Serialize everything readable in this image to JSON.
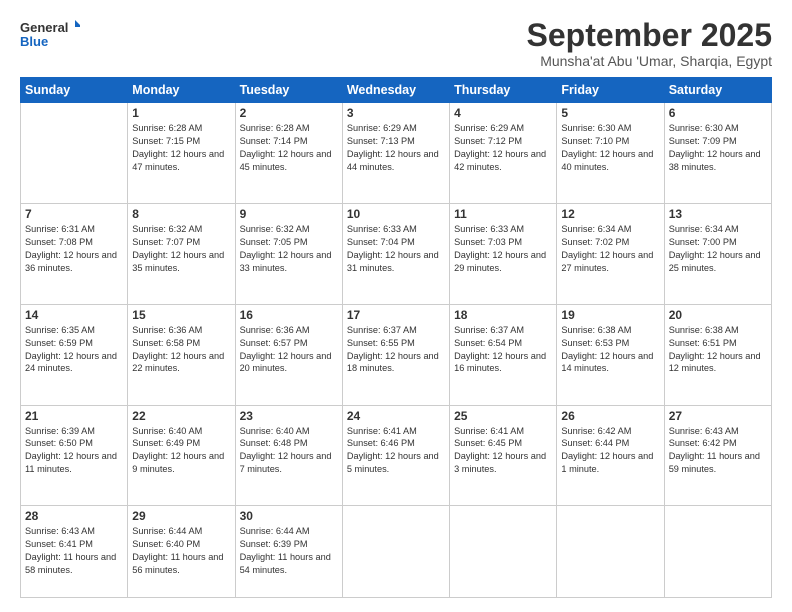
{
  "logo": {
    "line1": "General",
    "line2": "Blue"
  },
  "title": "September 2025",
  "location": "Munsha'at Abu 'Umar, Sharqia, Egypt",
  "days_of_week": [
    "Sunday",
    "Monday",
    "Tuesday",
    "Wednesday",
    "Thursday",
    "Friday",
    "Saturday"
  ],
  "weeks": [
    [
      {
        "day": "",
        "info": ""
      },
      {
        "day": "1",
        "info": "Sunrise: 6:28 AM\nSunset: 7:15 PM\nDaylight: 12 hours and 47 minutes."
      },
      {
        "day": "2",
        "info": "Sunrise: 6:28 AM\nSunset: 7:14 PM\nDaylight: 12 hours and 45 minutes."
      },
      {
        "day": "3",
        "info": "Sunrise: 6:29 AM\nSunset: 7:13 PM\nDaylight: 12 hours and 44 minutes."
      },
      {
        "day": "4",
        "info": "Sunrise: 6:29 AM\nSunset: 7:12 PM\nDaylight: 12 hours and 42 minutes."
      },
      {
        "day": "5",
        "info": "Sunrise: 6:30 AM\nSunset: 7:10 PM\nDaylight: 12 hours and 40 minutes."
      },
      {
        "day": "6",
        "info": "Sunrise: 6:30 AM\nSunset: 7:09 PM\nDaylight: 12 hours and 38 minutes."
      }
    ],
    [
      {
        "day": "7",
        "info": "Sunrise: 6:31 AM\nSunset: 7:08 PM\nDaylight: 12 hours and 36 minutes."
      },
      {
        "day": "8",
        "info": "Sunrise: 6:32 AM\nSunset: 7:07 PM\nDaylight: 12 hours and 35 minutes."
      },
      {
        "day": "9",
        "info": "Sunrise: 6:32 AM\nSunset: 7:05 PM\nDaylight: 12 hours and 33 minutes."
      },
      {
        "day": "10",
        "info": "Sunrise: 6:33 AM\nSunset: 7:04 PM\nDaylight: 12 hours and 31 minutes."
      },
      {
        "day": "11",
        "info": "Sunrise: 6:33 AM\nSunset: 7:03 PM\nDaylight: 12 hours and 29 minutes."
      },
      {
        "day": "12",
        "info": "Sunrise: 6:34 AM\nSunset: 7:02 PM\nDaylight: 12 hours and 27 minutes."
      },
      {
        "day": "13",
        "info": "Sunrise: 6:34 AM\nSunset: 7:00 PM\nDaylight: 12 hours and 25 minutes."
      }
    ],
    [
      {
        "day": "14",
        "info": "Sunrise: 6:35 AM\nSunset: 6:59 PM\nDaylight: 12 hours and 24 minutes."
      },
      {
        "day": "15",
        "info": "Sunrise: 6:36 AM\nSunset: 6:58 PM\nDaylight: 12 hours and 22 minutes."
      },
      {
        "day": "16",
        "info": "Sunrise: 6:36 AM\nSunset: 6:57 PM\nDaylight: 12 hours and 20 minutes."
      },
      {
        "day": "17",
        "info": "Sunrise: 6:37 AM\nSunset: 6:55 PM\nDaylight: 12 hours and 18 minutes."
      },
      {
        "day": "18",
        "info": "Sunrise: 6:37 AM\nSunset: 6:54 PM\nDaylight: 12 hours and 16 minutes."
      },
      {
        "day": "19",
        "info": "Sunrise: 6:38 AM\nSunset: 6:53 PM\nDaylight: 12 hours and 14 minutes."
      },
      {
        "day": "20",
        "info": "Sunrise: 6:38 AM\nSunset: 6:51 PM\nDaylight: 12 hours and 12 minutes."
      }
    ],
    [
      {
        "day": "21",
        "info": "Sunrise: 6:39 AM\nSunset: 6:50 PM\nDaylight: 12 hours and 11 minutes."
      },
      {
        "day": "22",
        "info": "Sunrise: 6:40 AM\nSunset: 6:49 PM\nDaylight: 12 hours and 9 minutes."
      },
      {
        "day": "23",
        "info": "Sunrise: 6:40 AM\nSunset: 6:48 PM\nDaylight: 12 hours and 7 minutes."
      },
      {
        "day": "24",
        "info": "Sunrise: 6:41 AM\nSunset: 6:46 PM\nDaylight: 12 hours and 5 minutes."
      },
      {
        "day": "25",
        "info": "Sunrise: 6:41 AM\nSunset: 6:45 PM\nDaylight: 12 hours and 3 minutes."
      },
      {
        "day": "26",
        "info": "Sunrise: 6:42 AM\nSunset: 6:44 PM\nDaylight: 12 hours and 1 minute."
      },
      {
        "day": "27",
        "info": "Sunrise: 6:43 AM\nSunset: 6:42 PM\nDaylight: 11 hours and 59 minutes."
      }
    ],
    [
      {
        "day": "28",
        "info": "Sunrise: 6:43 AM\nSunset: 6:41 PM\nDaylight: 11 hours and 58 minutes."
      },
      {
        "day": "29",
        "info": "Sunrise: 6:44 AM\nSunset: 6:40 PM\nDaylight: 11 hours and 56 minutes."
      },
      {
        "day": "30",
        "info": "Sunrise: 6:44 AM\nSunset: 6:39 PM\nDaylight: 11 hours and 54 minutes."
      },
      {
        "day": "",
        "info": ""
      },
      {
        "day": "",
        "info": ""
      },
      {
        "day": "",
        "info": ""
      },
      {
        "day": "",
        "info": ""
      }
    ]
  ]
}
